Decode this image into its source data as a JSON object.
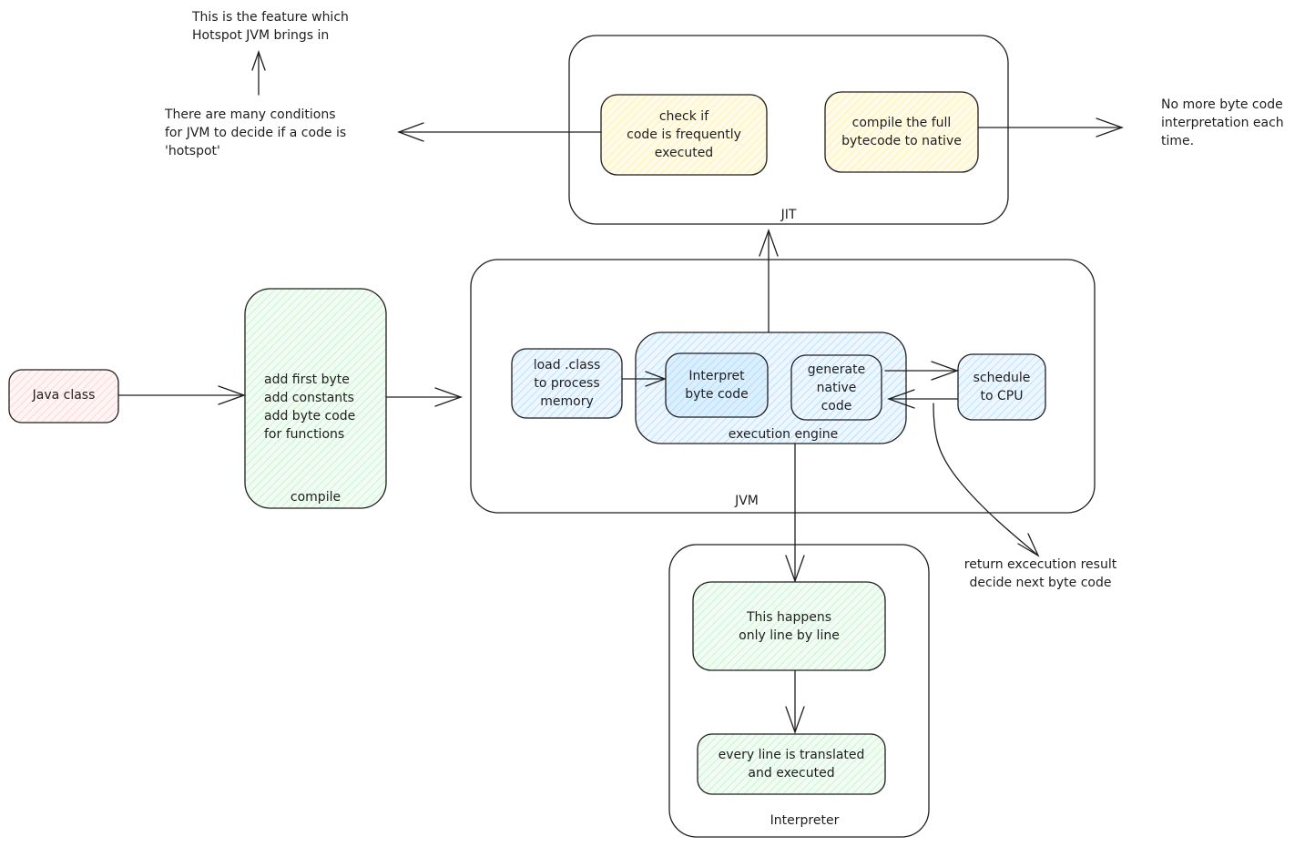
{
  "colors": {
    "stroke": "#1e1e1e",
    "pink_fill": "#ffc9c9",
    "green_fill": "#b2f2bb",
    "blue_fill": "#a5d8ff",
    "yellow_fill": "#ffec99",
    "background": "#ffffff"
  },
  "notes": {
    "hotspot_feature": "This is the feature which\nHotspot JVM brings in",
    "hotspot_conditions": "There are many conditions\nfor JVM to decide if a code is\n'hotspot'",
    "no_more_interpretation": "No more byte code\ninterpretation each\ntime.",
    "return_result": "return excecution result\ndecide next byte code"
  },
  "jit": {
    "label": "JIT",
    "check_box": "check if\ncode is frequently\nexecuted",
    "compile_box": "compile the full\nbytecode to native"
  },
  "java_class": {
    "label": "Java class"
  },
  "compile": {
    "label": "compile",
    "steps": "add first byte\nadd constants\nadd byte code\nfor functions"
  },
  "jvm": {
    "label": "JVM",
    "load_box": "load .class\nto process\nmemory",
    "execution_engine": {
      "label": "execution engine",
      "interpret_box": "Interpret\nbyte code",
      "generate_box": "generate\nnative\ncode"
    },
    "schedule_box": "schedule\nto CPU"
  },
  "interpreter": {
    "label": "Interpreter",
    "line_by_line_box": "This happens\nonly line by line",
    "translated_box": "every line is translated\nand executed"
  }
}
